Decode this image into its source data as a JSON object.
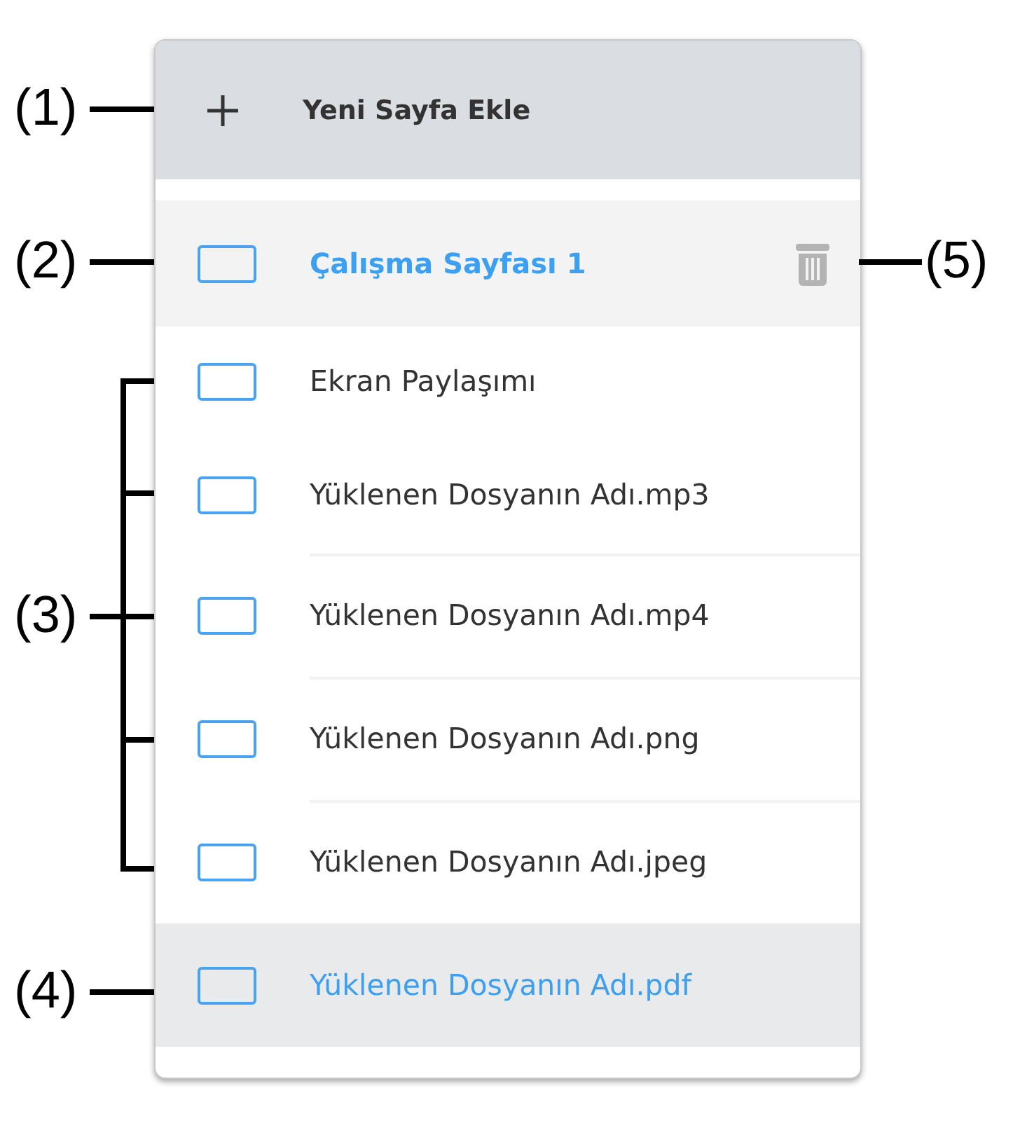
{
  "callouts": [
    {
      "label": "(1)",
      "kind": "line"
    },
    {
      "label": "(2)",
      "kind": "line"
    },
    {
      "label": "(3)",
      "kind": "bracket"
    },
    {
      "label": "(4)",
      "kind": "line"
    },
    {
      "label": "(5)",
      "kind": "line"
    }
  ],
  "header": {
    "label": "Yeni Sayfa Ekle"
  },
  "pages": [
    {
      "label": "Çalışma Sayfası 1",
      "selected": true,
      "hovered": false
    },
    {
      "label": "Ekran Paylaşımı",
      "selected": false,
      "hovered": false
    },
    {
      "label": "Yüklenen Dosyanın Adı.mp3",
      "selected": false,
      "hovered": false
    },
    {
      "label": "Yüklenen Dosyanın Adı.mp4",
      "selected": false,
      "hovered": false
    },
    {
      "label": "Yüklenen Dosyanın Adı.png",
      "selected": false,
      "hovered": false
    },
    {
      "label": "Yüklenen Dosyanın Adı.jpeg",
      "selected": false,
      "hovered": false
    },
    {
      "label": "Yüklenen Dosyanın Adı.pdf",
      "selected": false,
      "hovered": true
    }
  ]
}
